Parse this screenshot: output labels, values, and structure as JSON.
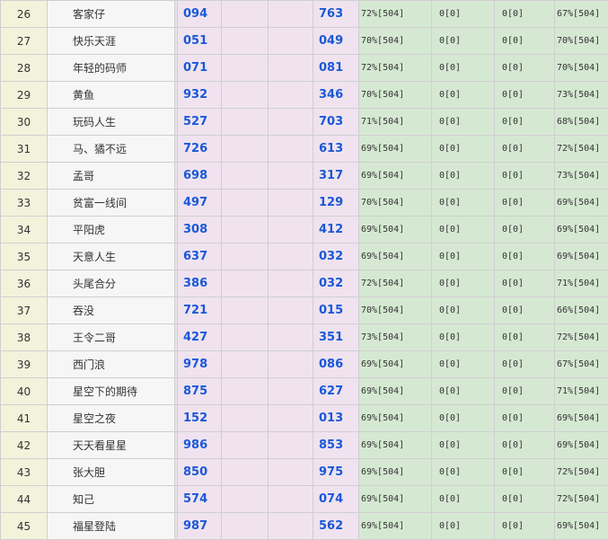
{
  "rows": [
    {
      "rank": "26",
      "name": "客家仔",
      "num1": "094",
      "num2": "763",
      "stat1": "72%[504]",
      "stat2": "0[0]",
      "stat3": "0[0]",
      "stat4": "67%[504]"
    },
    {
      "rank": "27",
      "name": "快乐天涯",
      "num1": "051",
      "num2": "049",
      "stat1": "70%[504]",
      "stat2": "0[0]",
      "stat3": "0[0]",
      "stat4": "70%[504]"
    },
    {
      "rank": "28",
      "name": "年轻的码师",
      "num1": "071",
      "num2": "081",
      "stat1": "72%[504]",
      "stat2": "0[0]",
      "stat3": "0[0]",
      "stat4": "70%[504]"
    },
    {
      "rank": "29",
      "name": "黄鱼",
      "num1": "932",
      "num2": "346",
      "stat1": "70%[504]",
      "stat2": "0[0]",
      "stat3": "0[0]",
      "stat4": "73%[504]"
    },
    {
      "rank": "30",
      "name": "玩码人生",
      "num1": "527",
      "num2": "703",
      "stat1": "71%[504]",
      "stat2": "0[0]",
      "stat3": "0[0]",
      "stat4": "68%[504]"
    },
    {
      "rank": "31",
      "name": "马、獝不远",
      "num1": "726",
      "num2": "613",
      "stat1": "69%[504]",
      "stat2": "0[0]",
      "stat3": "0[0]",
      "stat4": "72%[504]"
    },
    {
      "rank": "32",
      "name": "孟哥",
      "num1": "698",
      "num2": "317",
      "stat1": "69%[504]",
      "stat2": "0[0]",
      "stat3": "0[0]",
      "stat4": "73%[504]"
    },
    {
      "rank": "33",
      "name": "贫富一线间",
      "num1": "497",
      "num2": "129",
      "stat1": "70%[504]",
      "stat2": "0[0]",
      "stat3": "0[0]",
      "stat4": "69%[504]"
    },
    {
      "rank": "34",
      "name": "平阳虎",
      "num1": "308",
      "num2": "412",
      "stat1": "69%[504]",
      "stat2": "0[0]",
      "stat3": "0[0]",
      "stat4": "69%[504]"
    },
    {
      "rank": "35",
      "name": "天意人生",
      "num1": "637",
      "num2": "032",
      "stat1": "69%[504]",
      "stat2": "0[0]",
      "stat3": "0[0]",
      "stat4": "69%[504]"
    },
    {
      "rank": "36",
      "name": "头尾合分",
      "num1": "386",
      "num2": "032",
      "stat1": "72%[504]",
      "stat2": "0[0]",
      "stat3": "0[0]",
      "stat4": "71%[504]"
    },
    {
      "rank": "37",
      "name": "吞没",
      "num1": "721",
      "num2": "015",
      "stat1": "70%[504]",
      "stat2": "0[0]",
      "stat3": "0[0]",
      "stat4": "66%[504]"
    },
    {
      "rank": "38",
      "name": "王令二哥",
      "num1": "427",
      "num2": "351",
      "stat1": "73%[504]",
      "stat2": "0[0]",
      "stat3": "0[0]",
      "stat4": "72%[504]"
    },
    {
      "rank": "39",
      "name": "西门浪",
      "num1": "978",
      "num2": "086",
      "stat1": "69%[504]",
      "stat2": "0[0]",
      "stat3": "0[0]",
      "stat4": "67%[504]"
    },
    {
      "rank": "40",
      "name": "星空下的期待",
      "num1": "875",
      "num2": "627",
      "stat1": "69%[504]",
      "stat2": "0[0]",
      "stat3": "0[0]",
      "stat4": "71%[504]"
    },
    {
      "rank": "41",
      "name": "星空之夜",
      "num1": "152",
      "num2": "013",
      "stat1": "69%[504]",
      "stat2": "0[0]",
      "stat3": "0[0]",
      "stat4": "69%[504]"
    },
    {
      "rank": "42",
      "name": "天天看星星",
      "num1": "986",
      "num2": "853",
      "stat1": "69%[504]",
      "stat2": "0[0]",
      "stat3": "0[0]",
      "stat4": "69%[504]"
    },
    {
      "rank": "43",
      "name": "张大胆",
      "num1": "850",
      "num2": "975",
      "stat1": "69%[504]",
      "stat2": "0[0]",
      "stat3": "0[0]",
      "stat4": "72%[504]"
    },
    {
      "rank": "44",
      "name": "知己",
      "num1": "574",
      "num2": "074",
      "stat1": "69%[504]",
      "stat2": "0[0]",
      "stat3": "0[0]",
      "stat4": "72%[504]"
    },
    {
      "rank": "45",
      "name": "福星登陆",
      "num1": "987",
      "num2": "562",
      "stat1": "69%[504]",
      "stat2": "0[0]",
      "stat3": "0[0]",
      "stat4": "69%[504]"
    }
  ]
}
